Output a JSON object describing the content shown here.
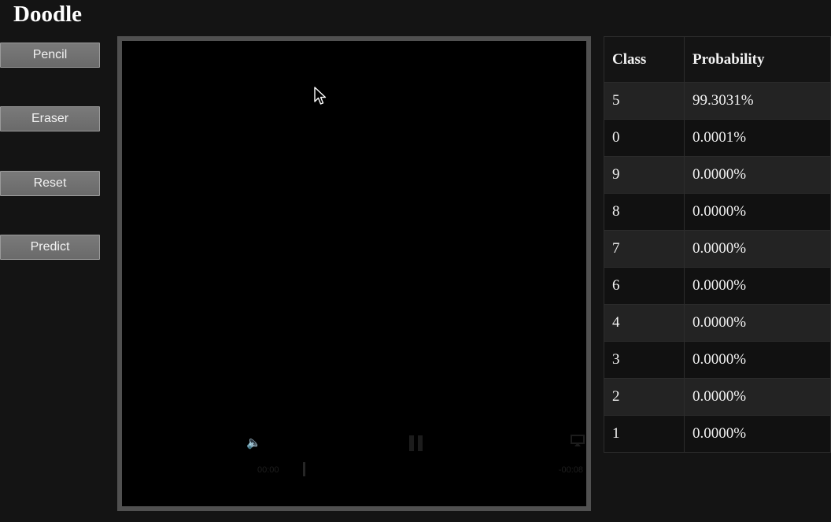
{
  "app": {
    "title": "Doodle"
  },
  "toolbar": {
    "pencil_label": "Pencil",
    "eraser_label": "Eraser",
    "reset_label": "Reset",
    "predict_label": "Predict"
  },
  "media": {
    "time_elapsed": "00:00",
    "time_remaining": "-00:08",
    "volume_icon": "speaker-icon",
    "play_state_icon": "pause-icon",
    "airplay_icon": "airplay-icon"
  },
  "results": {
    "headers": {
      "class": "Class",
      "probability": "Probability"
    },
    "rows": [
      {
        "class": "5",
        "probability": "99.3031%"
      },
      {
        "class": "0",
        "probability": "0.0001%"
      },
      {
        "class": "9",
        "probability": "0.0000%"
      },
      {
        "class": "8",
        "probability": "0.0000%"
      },
      {
        "class": "7",
        "probability": "0.0000%"
      },
      {
        "class": "6",
        "probability": "0.0000%"
      },
      {
        "class": "4",
        "probability": "0.0000%"
      },
      {
        "class": "3",
        "probability": "0.0000%"
      },
      {
        "class": "2",
        "probability": "0.0000%"
      },
      {
        "class": "1",
        "probability": "0.0000%"
      }
    ]
  },
  "colors": {
    "background": "#141414",
    "button": "#707070",
    "canvas_border": "#505050",
    "canvas": "#000000"
  }
}
